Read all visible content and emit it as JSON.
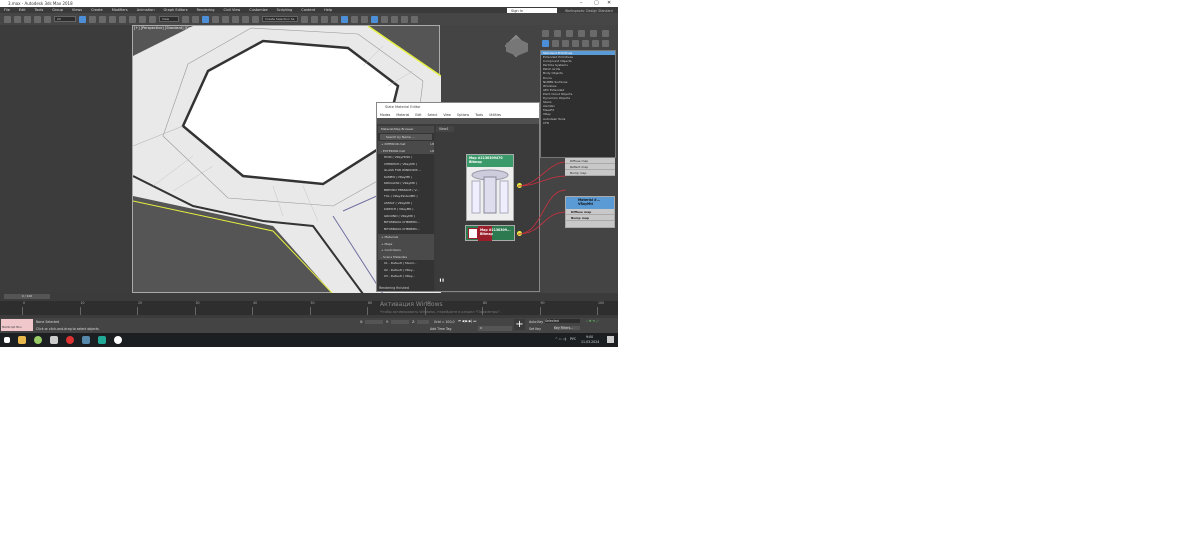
{
  "window": {
    "title": "3.max - Autodesk 3ds Max 2018",
    "min": "–",
    "max": "▢",
    "close": "✕"
  },
  "menu": [
    "File",
    "Edit",
    "Tools",
    "Group",
    "Views",
    "Create",
    "Modifiers",
    "Animation",
    "Graph Editors",
    "Rendering",
    "Civil View",
    "Customize",
    "Scripting",
    "Content",
    "Help"
  ],
  "toolbar": {
    "filter": "All",
    "view": "View",
    "selection_set": "Create Selection Se"
  },
  "signin": "Sign In",
  "workspace": "Workspaces:  Design Standard",
  "viewport": {
    "label": "[+] [Perspective] [Standard] [Default Shading]"
  },
  "command_panel": {
    "category": "Standard Primitives",
    "options": [
      "Standard Primitives",
      "Extended Primitives",
      "Compound Objects",
      "Particle Systems",
      "Patch Grids",
      "Body Objects",
      "Doors",
      "NURBS Surfaces",
      "Windows",
      "AEC Extended",
      "Point Cloud Objects",
      "Dynamics Objects",
      "Stairs",
      "Alembic",
      "MassFX",
      "VRay",
      "Autodesk Tools",
      "CFD"
    ]
  },
  "slate": {
    "title": "Slate Material Editor",
    "menu": [
      "Modes",
      "Material",
      "Edit",
      "Select",
      "View",
      "Options",
      "Tools",
      "Utilities"
    ],
    "browser_title": "Material/Map Browser",
    "search": "Search by Name ...",
    "view_tab": "View1",
    "groups": [
      {
        "name": "+ INTERIOR.mat",
        "count": "L8"
      },
      {
        "name": "- EXTERIOR.mat",
        "count": "L8"
      }
    ],
    "items": [
      "HDRI ( VRayHDRI )",
      "CHERPICH ( VRayMtl )",
      "GLASS FOR WINDOWS ...",
      "KAMEN ( VRayMtl )",
      "KRUGLYAK ( VRayMtl )",
      "BREVNO TERRACE ( V...",
      "TUL ( VRay2SidedMtl )",
      "ASFALT ( VRayMtl )",
      "KIRPICH ( VRayMtl )",
      "GROUND ( VRayMtl )",
      "BITUMNAYA CHEREPIC...",
      "BITUMNAYA CHEREPIC..."
    ],
    "sections": [
      "+ Materials",
      "+ Maps",
      "+ Controllers",
      "- Scene Materials"
    ],
    "scene_items": [
      "01 - Default ( Stand...",
      "02 - Default ( VRay...",
      "03 - Default ( VRay..."
    ],
    "node1": {
      "title": "Map #2130309470",
      "type": "Bitmap"
    },
    "node2": {
      "title": "Map #2130309...",
      "type": "Bitmap"
    },
    "mat_node": {
      "title": "Material #...",
      "type": "VRayMtl"
    },
    "slots_a": [
      "Diffuse map",
      "Reflect map",
      "Bump map"
    ],
    "slots_b": [
      "Diffuse map",
      "Bump map"
    ],
    "status": "Rendering finished"
  },
  "timeline": {
    "frame": "0 / 100",
    "ticks": [
      "0",
      "10",
      "20",
      "30",
      "40",
      "50",
      "60",
      "70",
      "80",
      "90",
      "100"
    ]
  },
  "status": {
    "selection": "None Selected",
    "hint": "Click or click-and-drag to select objects",
    "grid": "Grid = 100,0",
    "add_time_tag": "Add Time Tag",
    "x": "X:",
    "y": "Y:",
    "z": "Z:",
    "autokey": "Auto Key",
    "setkey": "Set Key",
    "selected": "Selected",
    "key_filters": "Key Filters...",
    "frame_field": "0",
    "maxscript": "MAXScript Mini"
  },
  "watermark": {
    "title": "Активация Windows",
    "sub": "Чтобы активировать Windows, перейдите в раздел \"Параметры\"."
  },
  "taskbar": {
    "lang": "РУС",
    "time": "9:00",
    "date": "11.03.2024"
  },
  "colors": {
    "accent": "#5b9bd5",
    "selection_outline": "#e6f040",
    "node_green": "#3a9a6a",
    "node_red": "#9a1f2a",
    "wire": "#d03040"
  }
}
